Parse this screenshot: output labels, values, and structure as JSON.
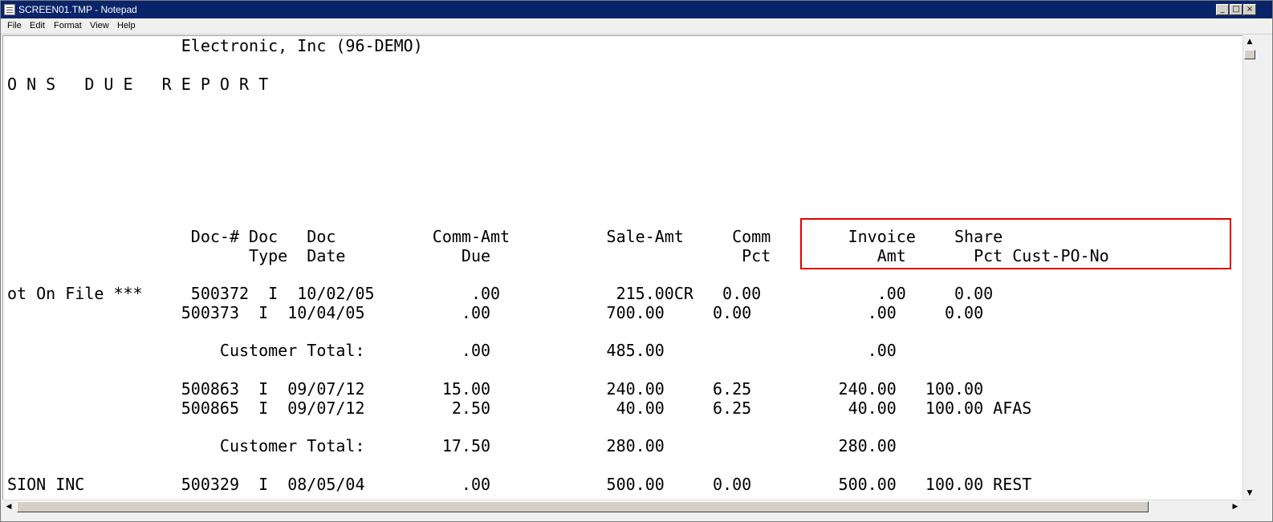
{
  "window": {
    "title": "SCREEN01.TMP - Notepad",
    "controls": {
      "minimize": "_",
      "maximize": "□",
      "close": "×"
    }
  },
  "menu": [
    "File",
    "Edit",
    "Format",
    "View",
    "Help"
  ],
  "document": {
    "lines": [
      "                  Electronic, Inc (96-DEMO)",
      "O N S   D U E   R E P O R T",
      "",
      "",
      "",
      "",
      "                   Doc-# Doc   Doc          Comm-Amt          Sale-Amt     Comm        Invoice    Share",
      "                         Type  Date            Due                          Pct           Amt       Pct Cust-PO-No",
      "ot On File ***     500372  I  10/02/05          .00            215.00CR   0.00            .00     0.00",
      "                  500373  I  10/04/05          .00            700.00     0.00            .00     0.00",
      "",
      "                      Customer Total:          .00            485.00                     .00",
      "",
      "                  500863  I  09/07/12        15.00            240.00     6.25         240.00   100.00",
      "                  500865  I  09/07/12         2.50             40.00     6.25          40.00   100.00 AFAS",
      "",
      "                      Customer Total:        17.50            280.00                  280.00",
      "",
      "SION INC          500329  I  08/05/04          .00            500.00     0.00         500.00   100.00 REST"
    ]
  },
  "icons": {
    "app": "notepad-icon",
    "scroll_up": "▲",
    "scroll_down": "▼",
    "scroll_left": "◀",
    "scroll_right": "▶"
  },
  "colors": {
    "title_bar": "#0a246a",
    "highlight_box": "#e00000"
  }
}
